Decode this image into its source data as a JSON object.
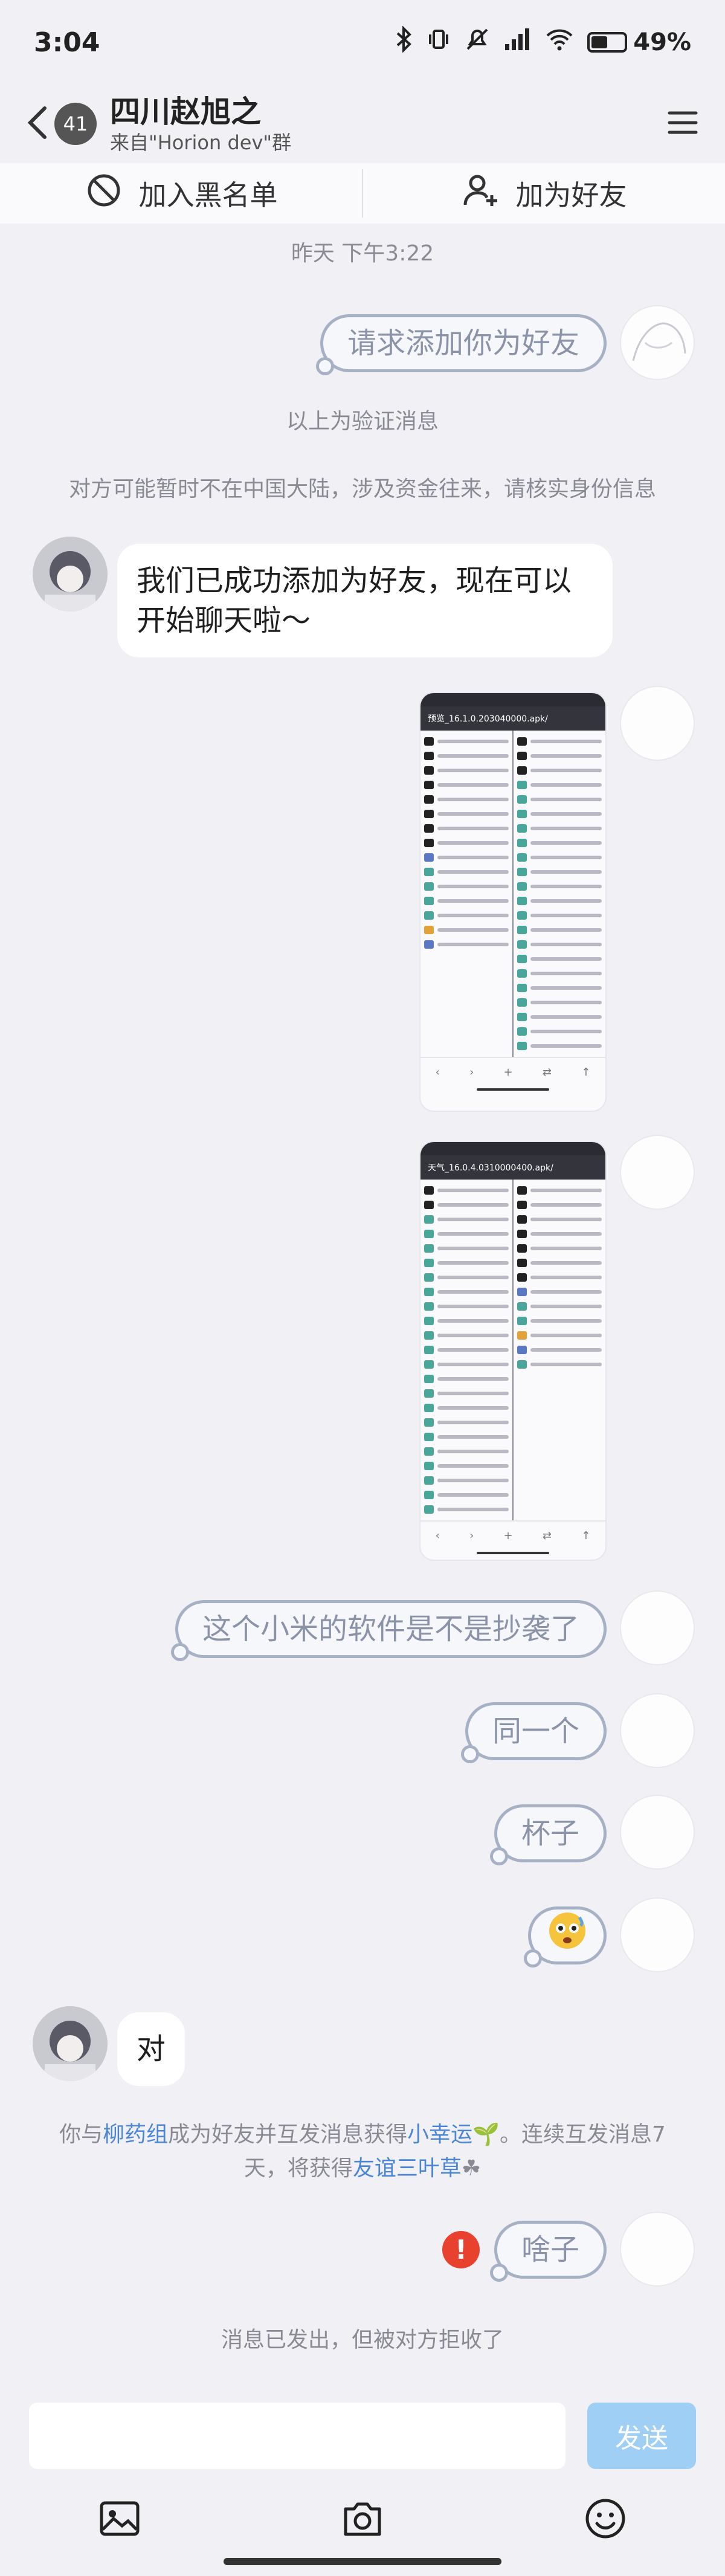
{
  "status_bar": {
    "time": "3:04",
    "battery": "49%",
    "battery_level": 0.49
  },
  "header": {
    "back_badge": "41",
    "title": "四川赵旭之",
    "subtitle": "来自\"Horion dev\"群"
  },
  "actions": {
    "block": "加入黑名单",
    "add_friend": "加为好友"
  },
  "chat": {
    "timestamp": "昨天 下午3:22",
    "request_msg": "请求添加你为好友",
    "verify_note": "以上为验证消息",
    "warning": "对方可能暂时不在中国大陆，涉及资金往来，请核实身份信息",
    "welcome": "我们已成功添加为好友，现在可以开始聊天啦～",
    "shot1_title": "预览_16.1.0.203040000.apk/",
    "shot2_title": "天气_16.0.4.0310000400.apk/",
    "msg_copy": "这个小米的软件是不是抄袭了",
    "msg_same": "同一个",
    "msg_cup": "杯子",
    "reply": "对",
    "friend_notice_1": "你与",
    "friend_notice_name": "柳药组",
    "friend_notice_2": "成为好友并互发消息获得",
    "friend_notice_luck": "小幸运",
    "friend_notice_3": "。连续互发消息7天，将获得",
    "friend_notice_clover": "友谊三叶草",
    "msg_what": "啥子",
    "rejected": "消息已发出，但被对方拒收了"
  },
  "input": {
    "placeholder": "",
    "send": "发送"
  },
  "icons": {
    "back": "chevron-left-icon",
    "menu": "hamburger-icon",
    "block": "block-icon",
    "add_friend": "add-person-icon",
    "image": "image-icon",
    "camera": "camera-icon",
    "emoji": "emoji-icon",
    "error": "error-icon"
  },
  "colors": {
    "send_disabled": "#9fcff5",
    "link": "#4b86d6",
    "error": "#e8412e"
  }
}
